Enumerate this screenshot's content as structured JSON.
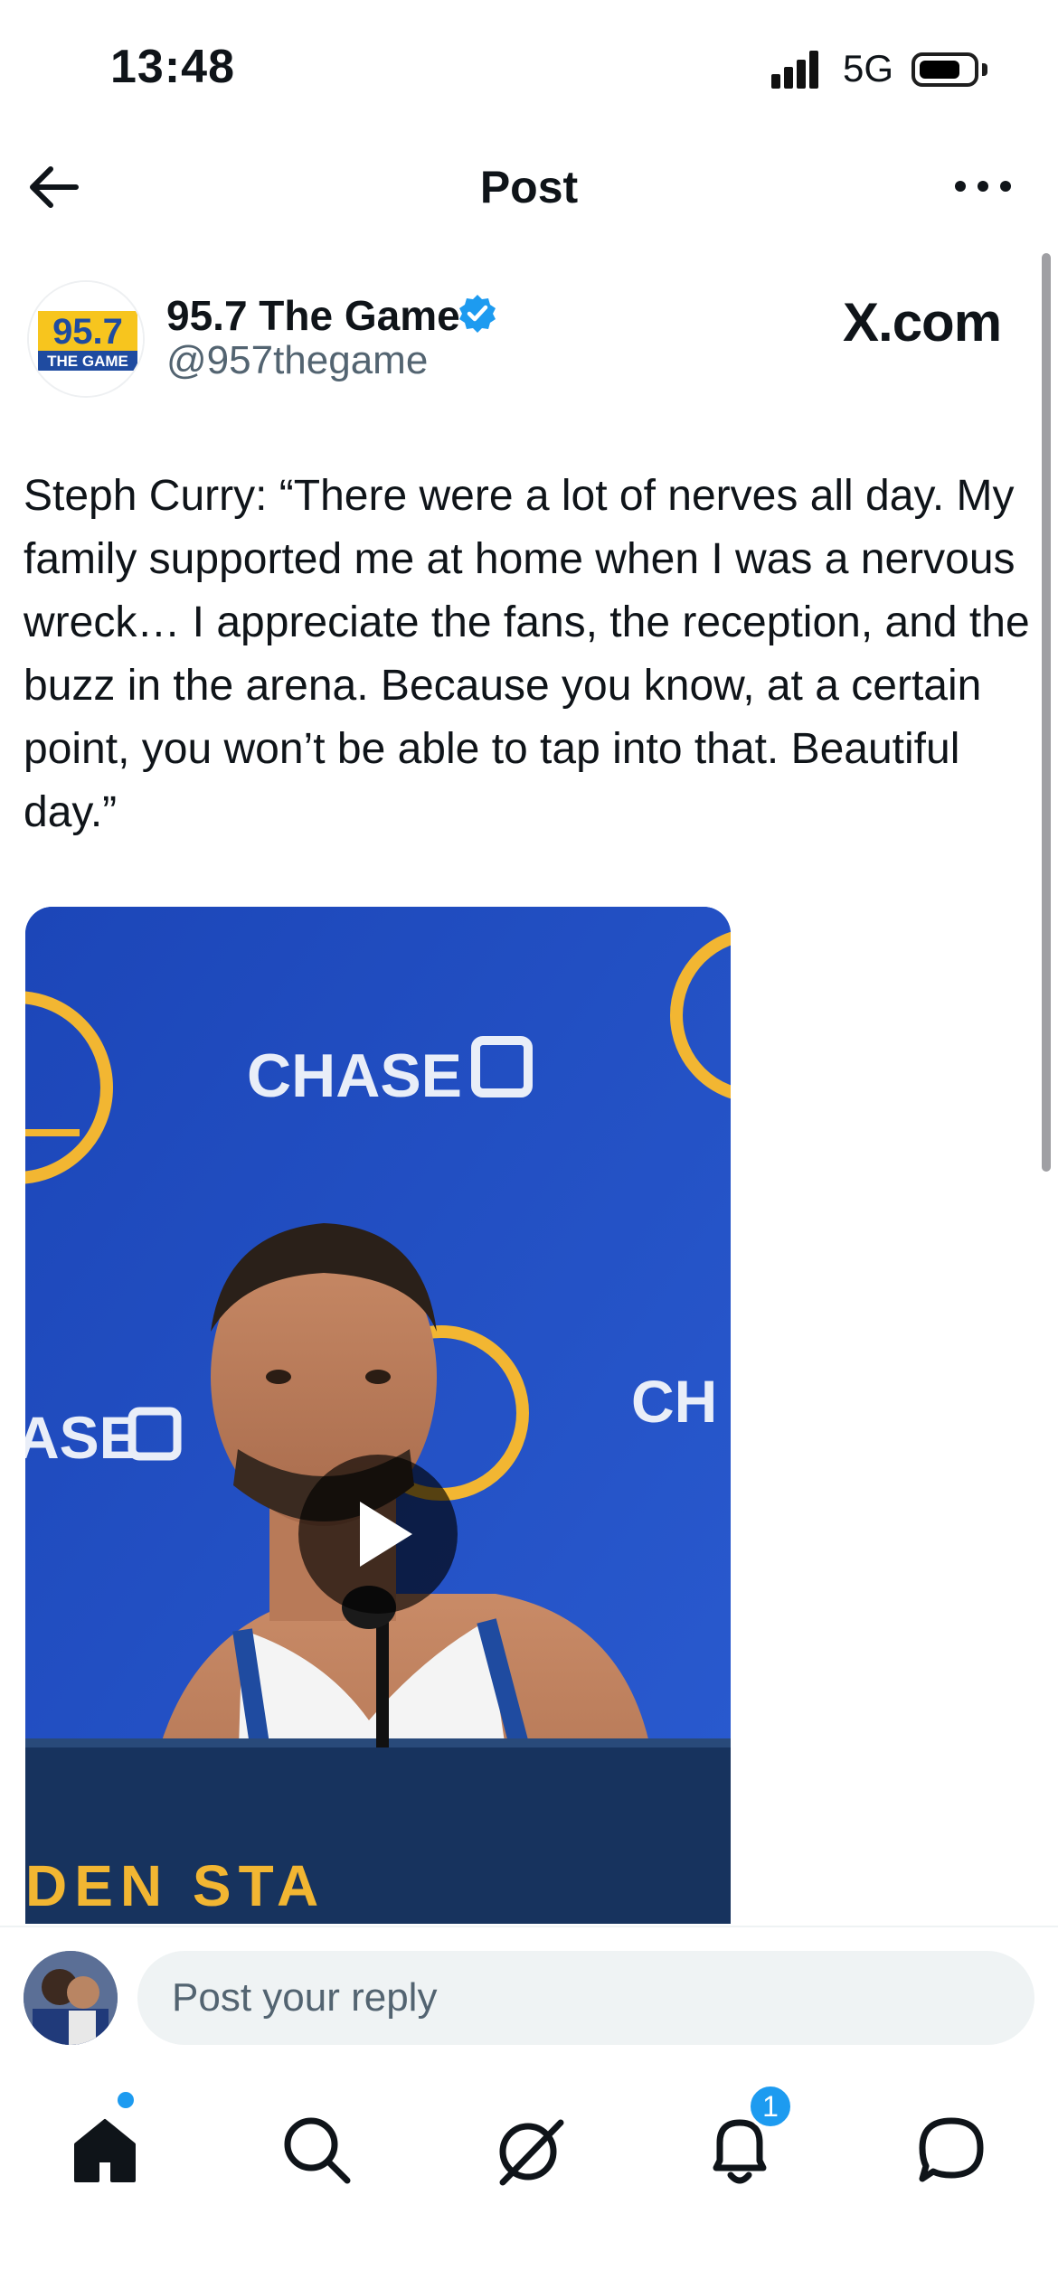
{
  "status_bar": {
    "time": "13:48",
    "network": "5G"
  },
  "header": {
    "title": "Post"
  },
  "author": {
    "display_name": "95.7 The Game",
    "handle": "@957thegame",
    "verified": true,
    "avatar_logo_number": "95.7",
    "avatar_logo_text": "THE GAME",
    "verified_color": "#1d9bf0"
  },
  "source_badge": "X.com",
  "post": {
    "text": "Steph Curry: “There were a lot of nerves all day. My family supported me at home when I was a nervous wreck… I appreciate the fans, the reception, and the buzz in the arena. Because you know, at a certain point, you won’t be able to tap into that. Beautiful day.”"
  },
  "video": {
    "backdrop_brand": "CHASE",
    "backdrop_brand_partial": "CH",
    "backdrop_brand_left_partial": "ASE",
    "table_text": "DEN STA",
    "play_icon": "play-icon"
  },
  "reply": {
    "placeholder": "Post your reply"
  },
  "nav": {
    "items": [
      "home-icon",
      "search-icon",
      "grok-icon",
      "notifications-icon",
      "messages-icon"
    ],
    "notification_count": "1",
    "accent": "#1d9bf0"
  }
}
